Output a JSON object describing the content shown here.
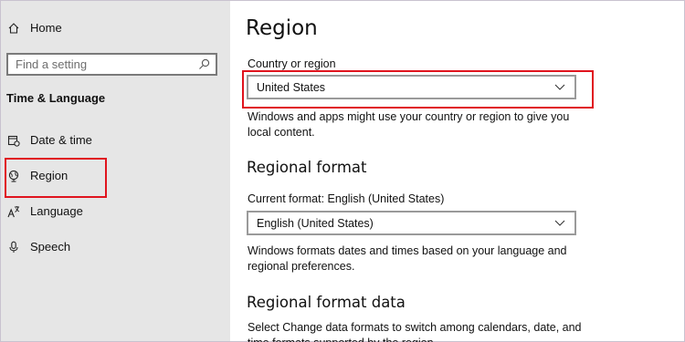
{
  "sidebar": {
    "home_label": "Home",
    "search_placeholder": "Find a setting",
    "section_title": "Time & Language",
    "items": [
      {
        "label": "Date & time",
        "icon": "calendar-clock-icon"
      },
      {
        "label": "Region",
        "icon": "globe-icon"
      },
      {
        "label": "Language",
        "icon": "language-icon"
      },
      {
        "label": "Speech",
        "icon": "microphone-icon"
      }
    ]
  },
  "main": {
    "title": "Region",
    "country": {
      "label": "Country or region",
      "value": "United States",
      "description": "Windows and apps might use your country or region to give you local content."
    },
    "regional_format": {
      "heading": "Regional format",
      "label": "Current format: English (United States)",
      "value": "English (United States)",
      "description": "Windows formats dates and times based on your language and regional preferences."
    },
    "regional_format_data": {
      "heading": "Regional format data",
      "description": "Select Change data formats to switch among calendars, date, and time formats supported by the region."
    }
  },
  "colors": {
    "sidebar_bg": "#e6e6e6",
    "highlight": "#e0141e"
  }
}
